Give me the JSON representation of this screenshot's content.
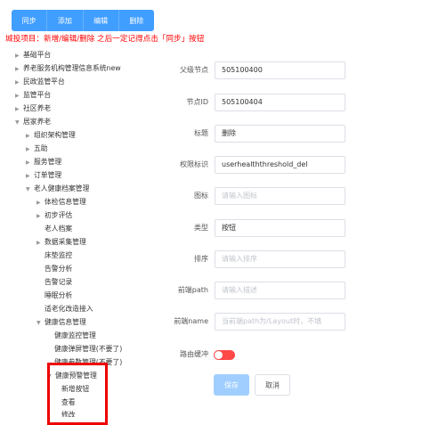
{
  "toolbar": {
    "sync_label": "同步",
    "add_label": "添加",
    "edit_label": "编辑",
    "delete_label": "删除"
  },
  "warning": "城投项目：新增/编辑/删除 之后一定记得点击「同步」按钮",
  "tree": [
    {
      "label": "基础平台",
      "expanded": false
    },
    {
      "label": "养老服务机构管理信息系统new",
      "expanded": false
    },
    {
      "label": "民政监管平台",
      "expanded": false
    },
    {
      "label": "监管平台",
      "expanded": false
    },
    {
      "label": "社区养老",
      "expanded": false
    },
    {
      "label": "居家养老",
      "expanded": true
    },
    {
      "label": "组织架构管理",
      "expanded": false
    },
    {
      "label": "五助",
      "expanded": false
    },
    {
      "label": "服务管理",
      "expanded": false
    },
    {
      "label": "订单管理",
      "expanded": false
    },
    {
      "label": "老人健康档案管理",
      "expanded": true
    },
    {
      "label": "体检信息管理",
      "expanded": false
    },
    {
      "label": "初步评估",
      "expanded": false
    },
    {
      "label": "老人档案",
      "expanded": null
    },
    {
      "label": "数据采集管理",
      "expanded": false
    },
    {
      "label": "床垫监控",
      "expanded": null
    },
    {
      "label": "告警分析",
      "expanded": null
    },
    {
      "label": "告警记录",
      "expanded": null
    },
    {
      "label": "睡眠分析",
      "expanded": null
    },
    {
      "label": "适老化改造接入",
      "expanded": null
    },
    {
      "label": "健康信息管理",
      "expanded": true
    },
    {
      "label": "健康监控管理",
      "expanded": null
    },
    {
      "label": "健康弹屏管理(不要了)",
      "expanded": null
    },
    {
      "label": "健康参数管理(不要了)",
      "expanded": null
    },
    {
      "label": "健康预警管理",
      "expanded": true
    },
    {
      "label": "新增按钮",
      "expanded": null
    },
    {
      "label": "查看",
      "expanded": null
    },
    {
      "label": "修改",
      "expanded": null
    }
  ],
  "form": {
    "parent_node_label": "父级节点",
    "parent_node_value": "505100400",
    "node_id_label": "节点ID",
    "node_id_value": "505100404",
    "title_label": "标题",
    "title_value": "删除",
    "permission_label": "权限标识",
    "permission_value": "userhealththreshold_del",
    "icon_label": "图标",
    "icon_placeholder": "请输入图标",
    "type_label": "类型",
    "type_value": "按钮",
    "sort_label": "排序",
    "sort_placeholder": "请输入排序",
    "frontend_path_label": "前端path",
    "frontend_path_placeholder": "请输入描述",
    "frontend_name_label": "前端name",
    "frontend_name_placeholder": "当前端path为/Layout时，不填",
    "route_cache_label": "路由缓冲",
    "route_cache_on": false,
    "save_label": "保存",
    "cancel_label": "取消"
  },
  "colors": {
    "primary": "#409eff",
    "warning_text": "#ff0000",
    "toggle_off": "#ff4949",
    "highlight_border": "#ee0000"
  }
}
